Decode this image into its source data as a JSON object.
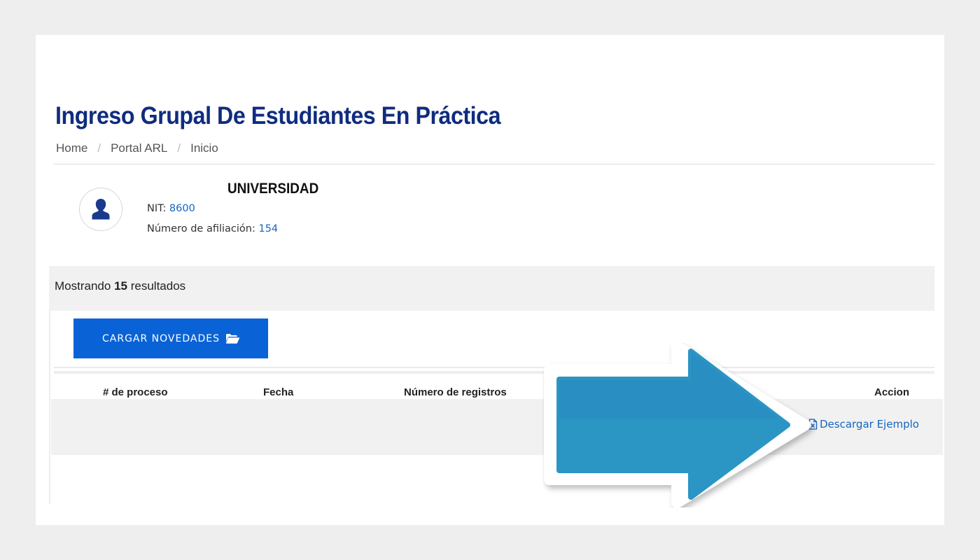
{
  "header": {
    "title": "Ingreso Grupal De Estudiantes En Práctica",
    "breadcrumb": [
      "Home",
      "Portal ARL",
      "Inicio"
    ],
    "separator": "/"
  },
  "entity": {
    "icon": "user-icon",
    "name": "UNIVERSIDAD",
    "nit_label": "NIT:",
    "nit_value": "8600",
    "affiliation_label": "Número de afiliación:",
    "affiliation_value": "154"
  },
  "results": {
    "prefix": "Mostrando",
    "count": "15",
    "suffix": "resultados"
  },
  "upload": {
    "label": "CARGAR NOVEDADES",
    "icon": "folder-open-icon"
  },
  "table": {
    "columns": [
      "# de proceso",
      "Fecha",
      "Número de registros",
      "Accion"
    ]
  },
  "download": {
    "label": "Descargar Ejemplo",
    "icon": "excel-file-icon"
  },
  "colors": {
    "title": "#0f2c7e",
    "accent": "#0a63d6",
    "link": "#1565c0",
    "arrow": "#2b95c4"
  }
}
